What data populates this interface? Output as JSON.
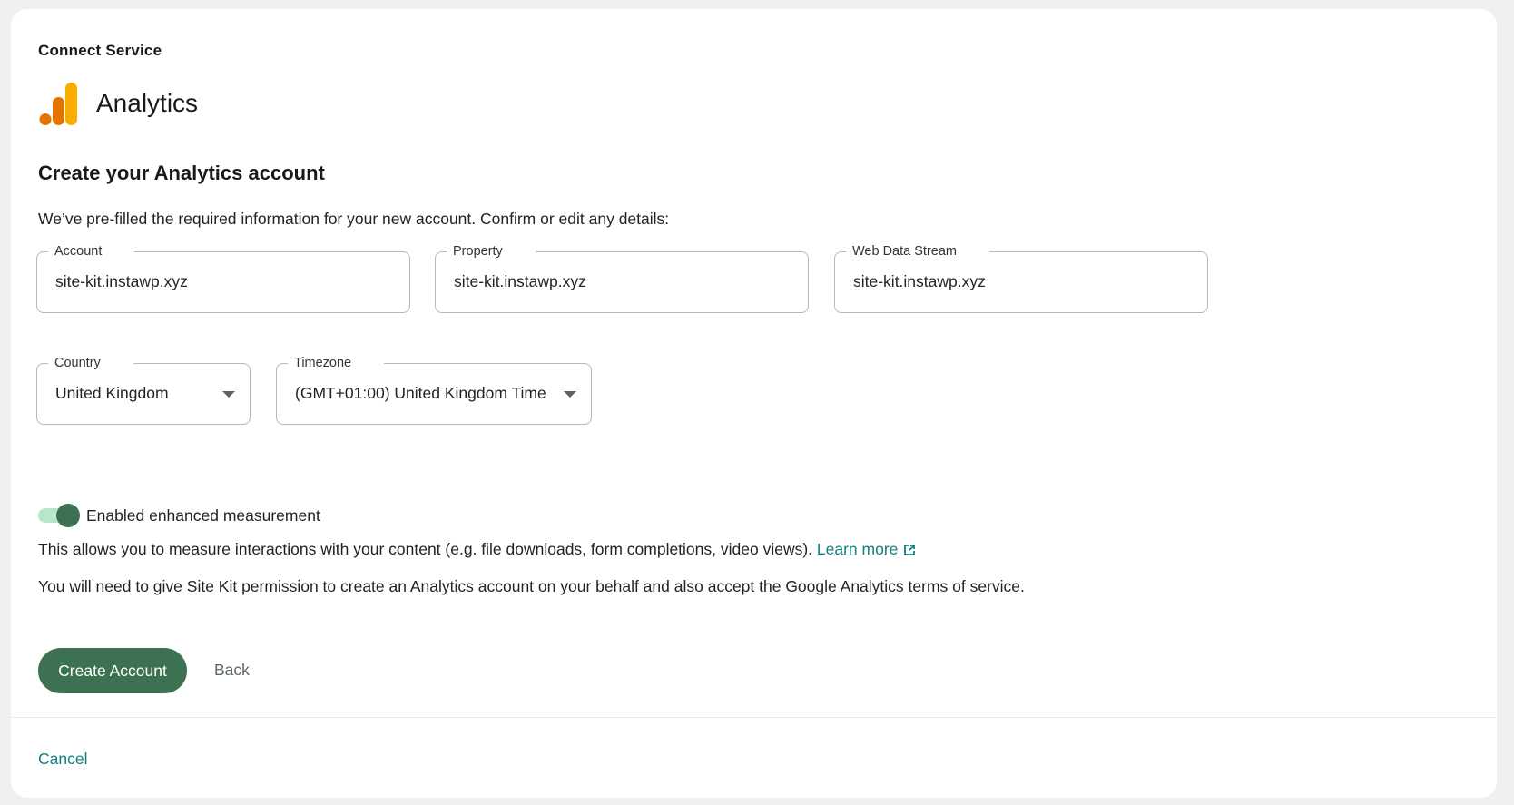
{
  "header": {
    "eyebrow": "Connect Service",
    "service_name": "Analytics",
    "logo_icon": "google-analytics-logo",
    "logo_colors": [
      "#e8710a",
      "#f9ab00"
    ]
  },
  "form": {
    "heading": "Create your Analytics account",
    "intro": "We’ve pre-filled the required information for your new account. Confirm or edit any details:",
    "account": {
      "label": "Account",
      "value": "site-kit.instawp.xyz"
    },
    "property": {
      "label": "Property",
      "value": "site-kit.instawp.xyz"
    },
    "web_data_stream": {
      "label": "Web Data Stream",
      "value": "site-kit.instawp.xyz"
    },
    "country": {
      "label": "Country",
      "value": "United Kingdom"
    },
    "timezone": {
      "label": "Timezone",
      "value": "(GMT+01:00) United Kingdom Time"
    },
    "enhanced_measurement": {
      "label": "Enabled enhanced measurement",
      "enabled": true
    },
    "enhanced_description": "This allows you to measure interactions with your content (e.g. file downloads, form completions, video views).",
    "learn_more": "Learn more",
    "permission_note": "You will need to give Site Kit permission to create an Analytics account on your behalf and also accept the Google Analytics terms of service."
  },
  "actions": {
    "create": "Create Account",
    "back": "Back",
    "cancel": "Cancel"
  },
  "colors": {
    "primary": "#3c7251",
    "toggle_track": "#b8e6ca",
    "link": "#108080"
  }
}
